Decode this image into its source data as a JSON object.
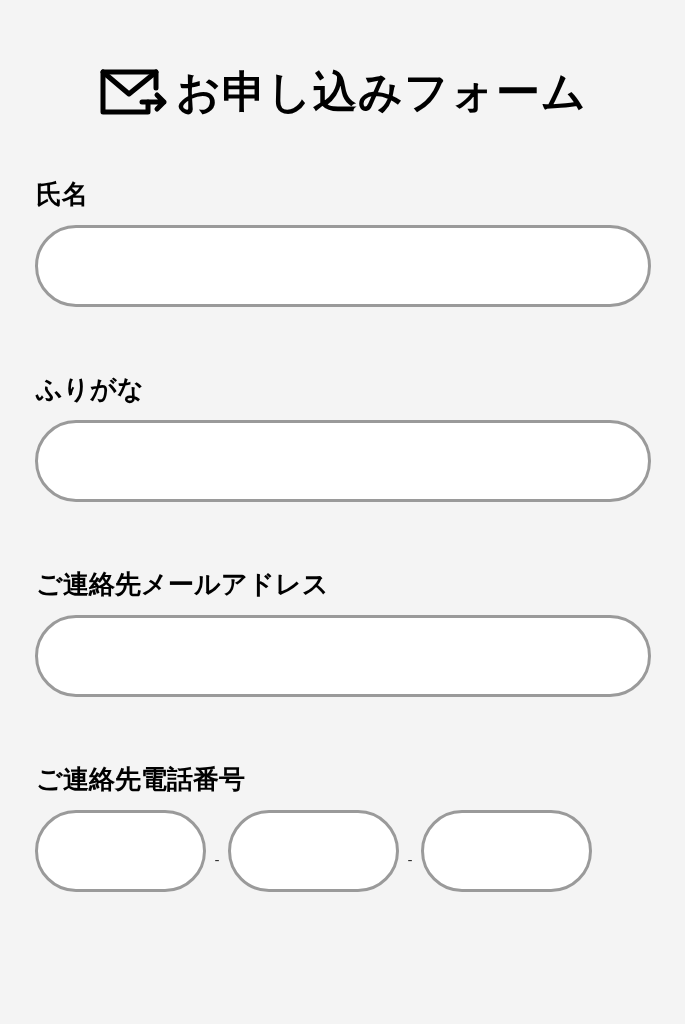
{
  "title": "お申し込みフォーム",
  "fields": [
    {
      "label": "氏名",
      "kind": "text"
    },
    {
      "label": "ふりがな",
      "kind": "text"
    },
    {
      "label": "ご連絡先メールアドレス",
      "kind": "text"
    },
    {
      "label": "ご連絡先電話番号",
      "kind": "phone",
      "separators": [
        "-",
        "-"
      ]
    }
  ]
}
